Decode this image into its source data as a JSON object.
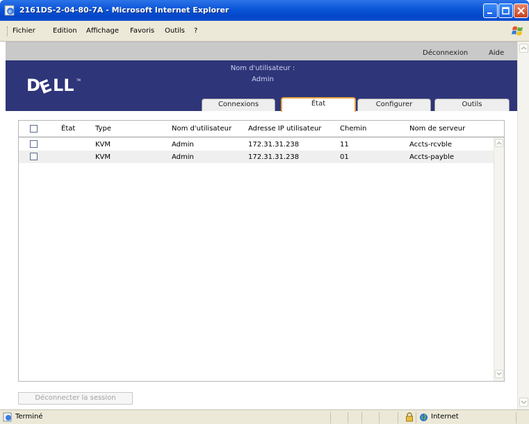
{
  "window": {
    "title": "2161DS-2-04-80-7A - Microsoft Internet Explorer"
  },
  "menu": [
    "Fichier",
    "Edition",
    "Affichage",
    "Favoris",
    "Outils",
    "?"
  ],
  "topbar": {
    "logout": "Déconnexion",
    "help": "Aide"
  },
  "header": {
    "user_label": "Nom d'utilisateur :",
    "user_value": "Admin",
    "logo_text": "DELL"
  },
  "tabs": [
    {
      "label": "Connexions",
      "active": false
    },
    {
      "label": "État",
      "active": true
    },
    {
      "label": "Configurer",
      "active": false
    },
    {
      "label": "Outils",
      "active": false
    }
  ],
  "table": {
    "columns": [
      "État",
      "Type",
      "Nom d'utilisateur",
      "Adresse IP utilisateur",
      "Chemin",
      "Nom de serveur"
    ],
    "rows": [
      {
        "state": "",
        "type": "KVM",
        "user": "Admin",
        "ip": "172.31.31.238",
        "path": "11",
        "server": "Accts-rcvble"
      },
      {
        "state": "",
        "type": "KVM",
        "user": "Admin",
        "ip": "172.31.31.238",
        "path": "01",
        "server": "Accts-payble"
      }
    ]
  },
  "actions": {
    "disconnect": "Déconnecter la session"
  },
  "status": {
    "text": "Terminé",
    "zone": "Internet"
  },
  "colors": {
    "header_blue": "#2e3579",
    "active_tab_border": "#e8a640",
    "titlebar_blue": "#0a55d8"
  }
}
